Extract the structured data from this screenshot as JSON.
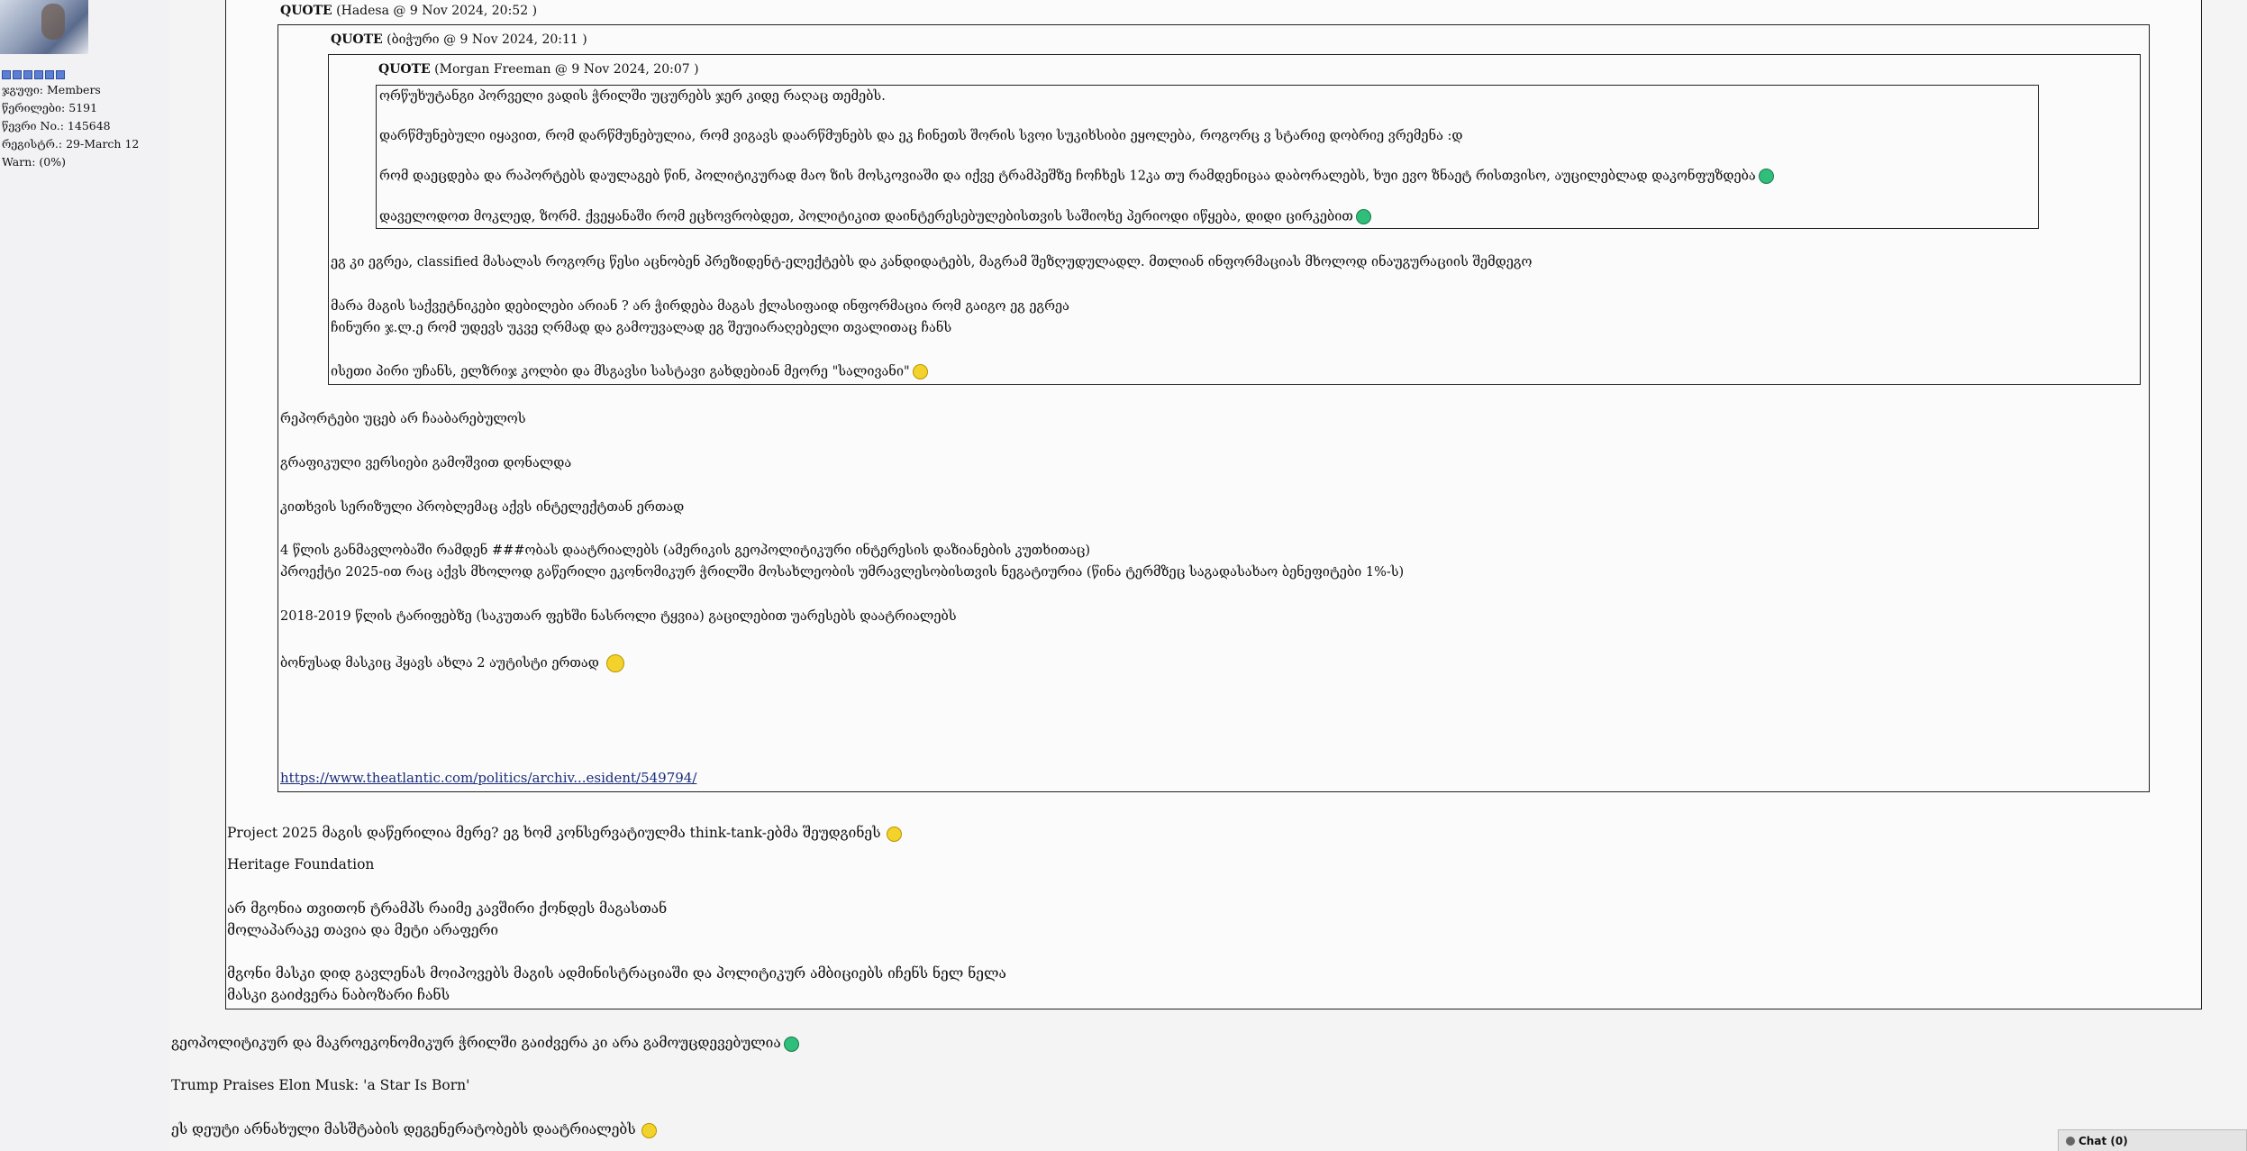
{
  "profile": {
    "group": "ჯგუფი: Members",
    "posts": "წერილები: 5191",
    "member_no": "წევრი No.: 145648",
    "registered": "რეგისტრ.: 29-March 12",
    "warn": "Warn: (0%)"
  },
  "quote1": {
    "label": "QUOTE",
    "meta": "(Hadesa @ 9 Nov 2024, 20:52 )"
  },
  "quote2": {
    "label": "QUOTE",
    "meta": "(ბიჭური @ 9 Nov 2024, 20:11 )"
  },
  "quote3": {
    "label": "QUOTE",
    "meta": "(Morgan Freeman @ 9 Nov 2024, 20:07 )",
    "lines": [
      "ორწუხუტანგი პორველი ვადის ჭრილში უცურებს ჯერ კიდე რაღაც თემებს.",
      "დარწმუნებული იყავით, რომ დარწმუნებულია, რომ ვიგავს დაარწმუნებს და ეკ ჩინეთს შორის სვოი სუკიხსიბი ეყოლება, როგორც ვ სტარიე დობრიე ვრემენა :დ",
      "რომ დაეცდება და რაპორტებს დაულაგებ წინ, პოლიტიკურად მაო ზის მოსკოვიაში და იქვე ტრამპეშზე ჩოჩხეს 12კა თუ რამდენიცაა დაბორალებს, ხუი ევო ზნაეტ რისთვისო, აუცილებლად დაკონფუზდება",
      "დაველოდოთ მოკლედ, ზორმ. ქვეყანაში რომ ეცხოვრობდეთ, პოლიტიკით დაინტერესებულებისთვის საშიოხე პერიოდი იწყება, დიდი ცირკებით"
    ]
  },
  "quote2_body": [
    "ეგ კი ეგრეა, classified მასალას როგორც წესი აცნობენ პრეზიდენტ-ელექტებს და კანდიდატებს, მაგრამ შეზღუდულადლ. მთლიან ინფორმაციას მხოლოდ ინაუგურაციის შემდეგო",
    "მარა მაგის საქვეტნიკები დებილები არიან ? არ ჭირდება მაგას ქლასიფაიდ ინფორმაცია რომ გაიგო ეგ ეგრეა",
    "ჩინური ჯ.ლ.ე რომ უდევს უკვე ღრმად და გამოუვალად ეგ შეუიარაღებელი თვალითაც ჩანს",
    "ისეთი პირი უჩანს, ელზრიჯ კოლბი და მსგავსი სასტავი გახდებიან მეორე \"სალივანი\""
  ],
  "quote1_body": [
    "რეპორტები უცებ არ ჩააბარებულოს",
    "გრაფიკული ვერსიები გამოშვით დონალდა",
    "კითხვის სერიზული პრობლემაც აქვს ინტელექტთან ერთად",
    "4 წლის განმავლობაში რამდენ ###ობას დაატრიალებს (ამერიკის გეოპოლიტიკური ინტერესის დაზიანების კუთხითაც)",
    "პროექტი 2025-ით რაც აქვს მხოლოდ გაწერილი ეკონომიკურ ჭრილში მოსახლეობის უმრავლესობისთვის ნეგატიურია (წინა ტერმზეც საგადასახაო ბენეფიტები 1%-ს)",
    "2018-2019 წლის ტარიფებზე (საკუთარ ფეხში ნასროლი ტყვია) გაცილებით უარესებს დაატრიალებს",
    "ბონუსად მასკიც ჰყავს ახლა 2 აუტისტი ერთად"
  ],
  "quote1_link": "https://www.theatlantic.com/politics/archiv...esident/549794/",
  "outer_body": [
    "Project 2025 მაგის დაწერილია მერე? ეგ ხომ კონსერვატიულმა think-tank-ებმა შეუდგინეს",
    "Heritage Foundation",
    "არ მგონია თვითონ ტრამპს რაიმე კავშირი ქონდეს მაგასთან",
    "მოლაპარაკე თავია და მეტი არაფერი",
    "მგონი მასკი დიდ გავლენას მოიპოვებს მაგის ადმინისტრაციაში და პოლიტიკურ ამბიციებს იჩენს ნელ ნელა",
    "მასკი გაიძვერა ნაბოზარი ჩანს"
  ],
  "reply": [
    "გეოპოლიტიკურ და მაკროეკონომიკურ ჭრილში გაიძვერა კი არა გამოუცდევებულია",
    "Trump Praises Elon Musk: 'a Star Is Born'",
    "ეს დეუტი არნახული მასშტაბის დეგენერატობებს დაატრიალებს"
  ],
  "chat": {
    "label": "Chat (0)"
  }
}
